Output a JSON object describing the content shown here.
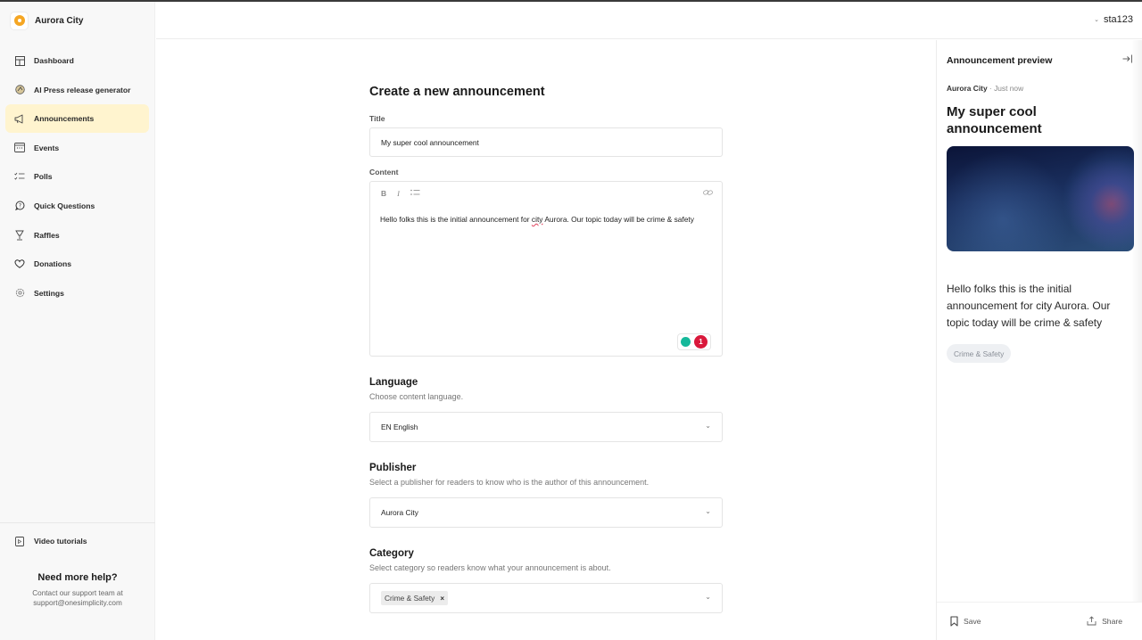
{
  "app": {
    "name": "Aurora City"
  },
  "sidebar": {
    "items": [
      {
        "label": "Dashboard",
        "icon": "dashboard-icon",
        "active": false
      },
      {
        "label": "AI Press release generator",
        "icon": "ai-icon",
        "active": false
      },
      {
        "label": "Announcements",
        "icon": "megaphone-icon",
        "active": true
      },
      {
        "label": "Events",
        "icon": "calendar-icon",
        "active": false
      },
      {
        "label": "Polls",
        "icon": "checklist-icon",
        "active": false
      },
      {
        "label": "Quick Questions",
        "icon": "question-bubble-icon",
        "active": false
      },
      {
        "label": "Raffles",
        "icon": "trophy-icon",
        "active": false
      },
      {
        "label": "Donations",
        "icon": "heart-icon",
        "active": false
      },
      {
        "label": "Settings",
        "icon": "gear-icon",
        "active": false
      }
    ],
    "video_tutorials": "Video tutorials",
    "help": {
      "title": "Need more help?",
      "text_line1": "Contact our support team at",
      "text_line2": "support@onesimplicity.com"
    }
  },
  "header": {
    "username": "sta123"
  },
  "form": {
    "page_title": "Create a new announcement",
    "title_label": "Title",
    "title_value": "My super cool announcement",
    "content_label": "Content",
    "toolbar": {
      "bold": "B",
      "italic": "I",
      "list": "list"
    },
    "content_before": "Hello folks this is the initial announcement for ",
    "content_misspelled": "city",
    "content_after": " Aurora. Our topic today will be crime & safety",
    "grammar_count": "1",
    "language": {
      "title": "Language",
      "subtitle": "Choose content language.",
      "value": "EN English"
    },
    "publisher": {
      "title": "Publisher",
      "subtitle": "Select a publisher for readers to know who is the author of this announcement.",
      "value": "Aurora City"
    },
    "category": {
      "title": "Category",
      "subtitle": "Select category so readers know what your announcement is about.",
      "selected": [
        "Crime & Safety"
      ]
    }
  },
  "preview": {
    "header": "Announcement preview",
    "publisher": "Aurora City",
    "separator": " · ",
    "time": "Just now",
    "title": "My super cool announcement",
    "body": "Hello folks this is the initial announcement for city Aurora. Our topic today will be crime & safety",
    "category": "Crime & Safety",
    "save_label": "Save",
    "share_label": "Share"
  }
}
